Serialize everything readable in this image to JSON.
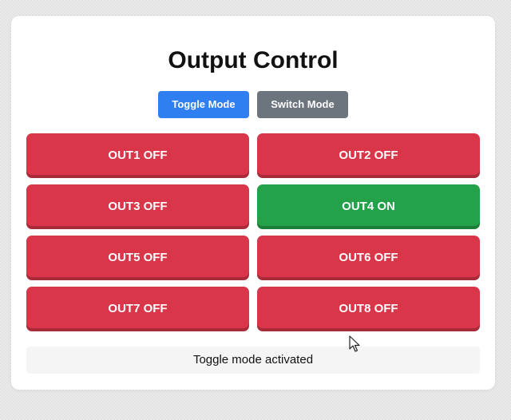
{
  "page": {
    "title": "Output Control"
  },
  "modes": {
    "toggle_label": "Toggle Mode",
    "switch_label": "Switch Mode"
  },
  "outputs": [
    {
      "label": "OUT1 OFF",
      "state": "off"
    },
    {
      "label": "OUT2 OFF",
      "state": "off"
    },
    {
      "label": "OUT3 OFF",
      "state": "off"
    },
    {
      "label": "OUT4 ON",
      "state": "on"
    },
    {
      "label": "OUT5 OFF",
      "state": "off"
    },
    {
      "label": "OUT6 OFF",
      "state": "off"
    },
    {
      "label": "OUT7 OFF",
      "state": "off"
    },
    {
      "label": "OUT8 OFF",
      "state": "off"
    }
  ],
  "status": {
    "message": "Toggle mode activated"
  },
  "colors": {
    "off": "#d9364a",
    "on": "#23a24a",
    "toggle_mode": "#2f7ff0",
    "switch_mode": "#6c757d"
  },
  "icons": {
    "cursor": "mouse-pointer-icon"
  }
}
